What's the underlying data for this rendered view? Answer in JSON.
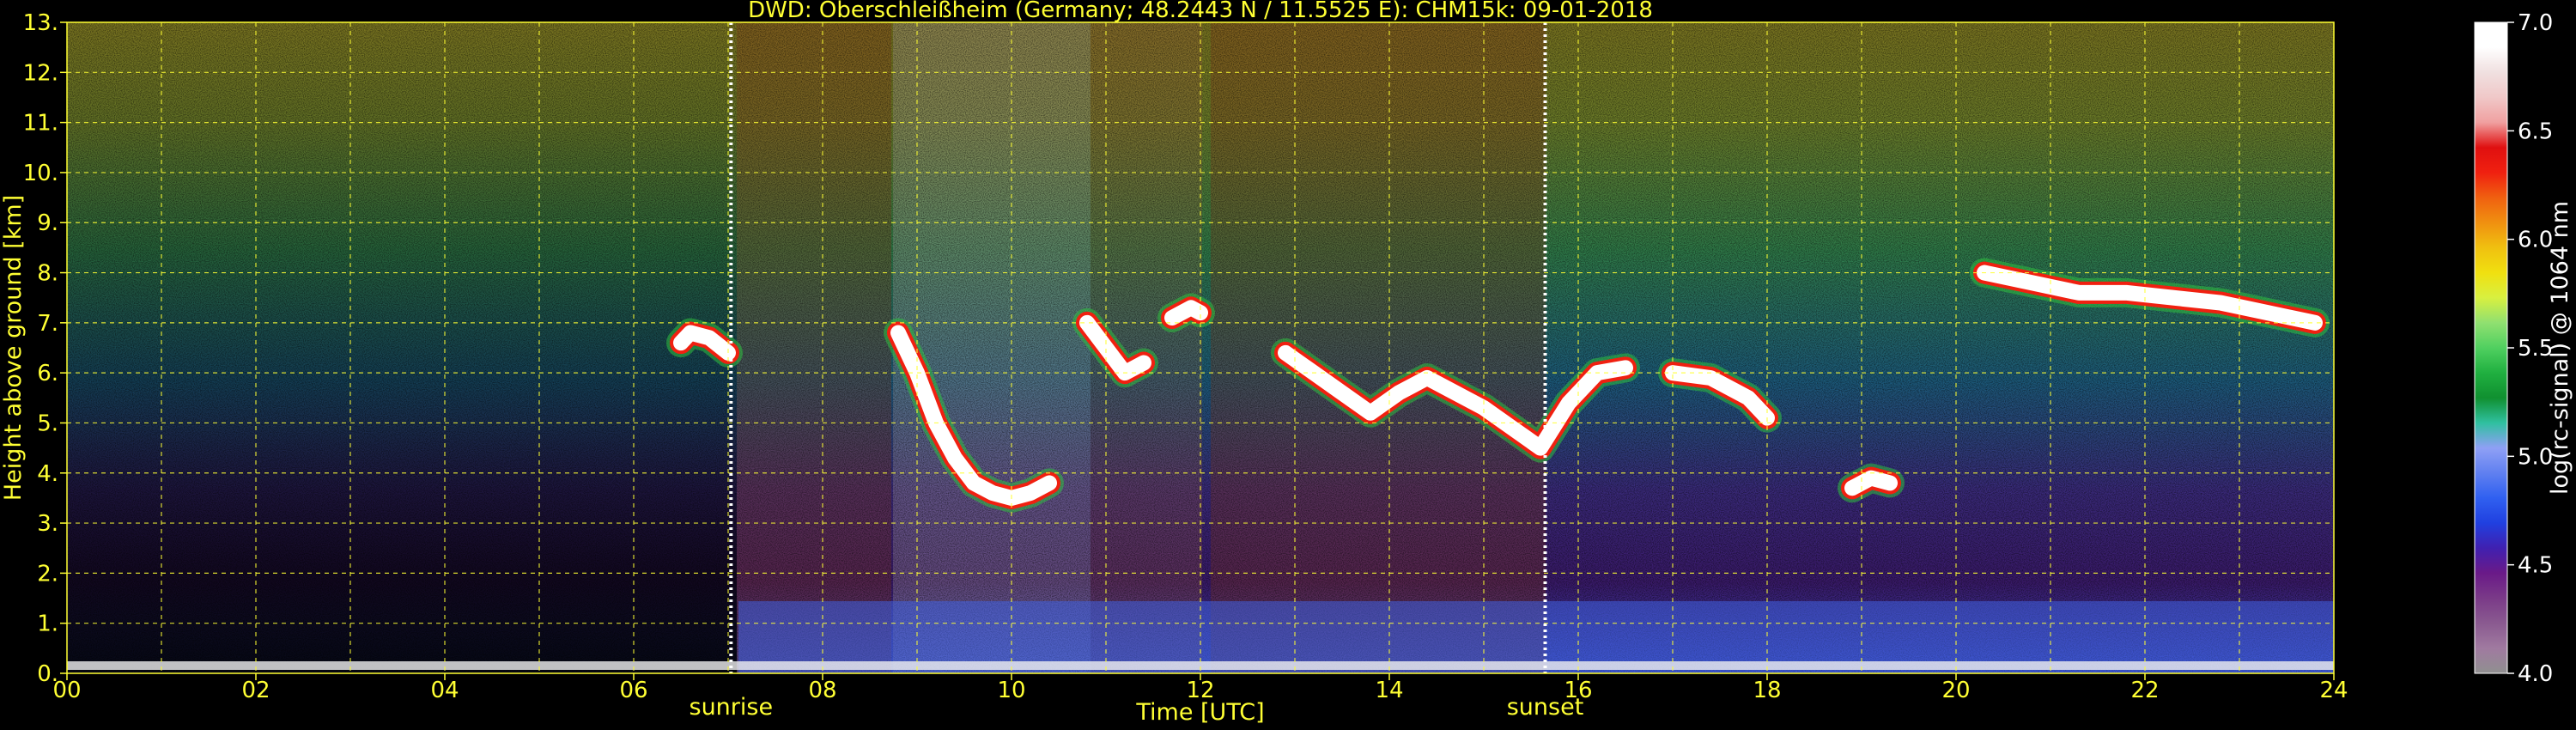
{
  "chart_data": {
    "type": "heatmap",
    "title": "DWD: Oberschleißheim (Germany; 48.2443 N / 11.5525 E):    CHM15k: 09-01-2018",
    "xlabel": "Time [UTC]",
    "ylabel": "Height above ground [km]",
    "xlim": [
      0,
      24
    ],
    "ylim": [
      0,
      13
    ],
    "x_ticks": [
      "00",
      "02",
      "04",
      "06",
      "08",
      "10",
      "12",
      "14",
      "16",
      "18",
      "20",
      "22",
      "24"
    ],
    "y_ticks": [
      "0.",
      "1.",
      "2.",
      "3.",
      "4.",
      "5.",
      "6.",
      "7.",
      "8.",
      "9.",
      "10.",
      "11.",
      "12.",
      "13."
    ],
    "grid": true,
    "grid_color": "#ffff33",
    "annotations": [
      {
        "label": "sunrise",
        "x": 7.03
      },
      {
        "label": "sunset",
        "x": 15.65
      }
    ],
    "colorbar": {
      "label": "log(rc-signal) @ 1064 nm",
      "range": [
        4.0,
        7.0
      ],
      "ticks": [
        "4.0",
        "4.5",
        "5.0",
        "5.5",
        "6.0",
        "6.5",
        "7.0"
      ],
      "colors": [
        "#909090",
        "#a07aa0",
        "#8a5a90",
        "#7a3a88",
        "#6a1a88",
        "#4020b0",
        "#2040e0",
        "#3060f0",
        "#6080f0",
        "#8fa0f5",
        "#30c0a0",
        "#109030",
        "#20b040",
        "#50d060",
        "#90e070",
        "#d8f040",
        "#f0e010",
        "#f0c010",
        "#f09010",
        "#f06010",
        "#f02010",
        "#e01010",
        "#f0a0a0",
        "#f0c8c8",
        "#f0e0e0",
        "#ffffff",
        "#ffffff"
      ]
    },
    "cloud_layers": [
      {
        "x": [
          6.5,
          6.6,
          6.8,
          7.0
        ],
        "y": [
          6.6,
          6.8,
          6.7,
          6.4
        ]
      },
      {
        "x": [
          8.8,
          9.0,
          9.2,
          9.4,
          9.6,
          9.8,
          10.0,
          10.2,
          10.4
        ],
        "y": [
          6.8,
          6.0,
          5.0,
          4.3,
          3.8,
          3.6,
          3.5,
          3.6,
          3.8
        ]
      },
      {
        "x": [
          10.8,
          11.0,
          11.2,
          11.4
        ],
        "y": [
          7.0,
          6.5,
          6.0,
          6.2
        ]
      },
      {
        "x": [
          11.7,
          11.9,
          12.0
        ],
        "y": [
          7.1,
          7.3,
          7.2
        ]
      },
      {
        "x": [
          12.9,
          13.2,
          13.5,
          13.8,
          14.1,
          14.4,
          14.7,
          15.0,
          15.3,
          15.6,
          15.9,
          16.2,
          16.5
        ],
        "y": [
          6.4,
          6.0,
          5.6,
          5.2,
          5.6,
          5.9,
          5.6,
          5.3,
          4.9,
          4.5,
          5.4,
          6.0,
          6.1
        ]
      },
      {
        "x": [
          17.0,
          17.4,
          17.8,
          18.0
        ],
        "y": [
          6.0,
          5.9,
          5.5,
          5.1
        ]
      },
      {
        "x": [
          18.9,
          19.1,
          19.3
        ],
        "y": [
          3.7,
          3.9,
          3.8
        ]
      },
      {
        "x": [
          20.3,
          20.8,
          21.3,
          21.8,
          22.3,
          22.8,
          23.3,
          23.8
        ],
        "y": [
          8.0,
          7.8,
          7.6,
          7.6,
          7.5,
          7.4,
          7.2,
          7.0
        ]
      }
    ]
  }
}
